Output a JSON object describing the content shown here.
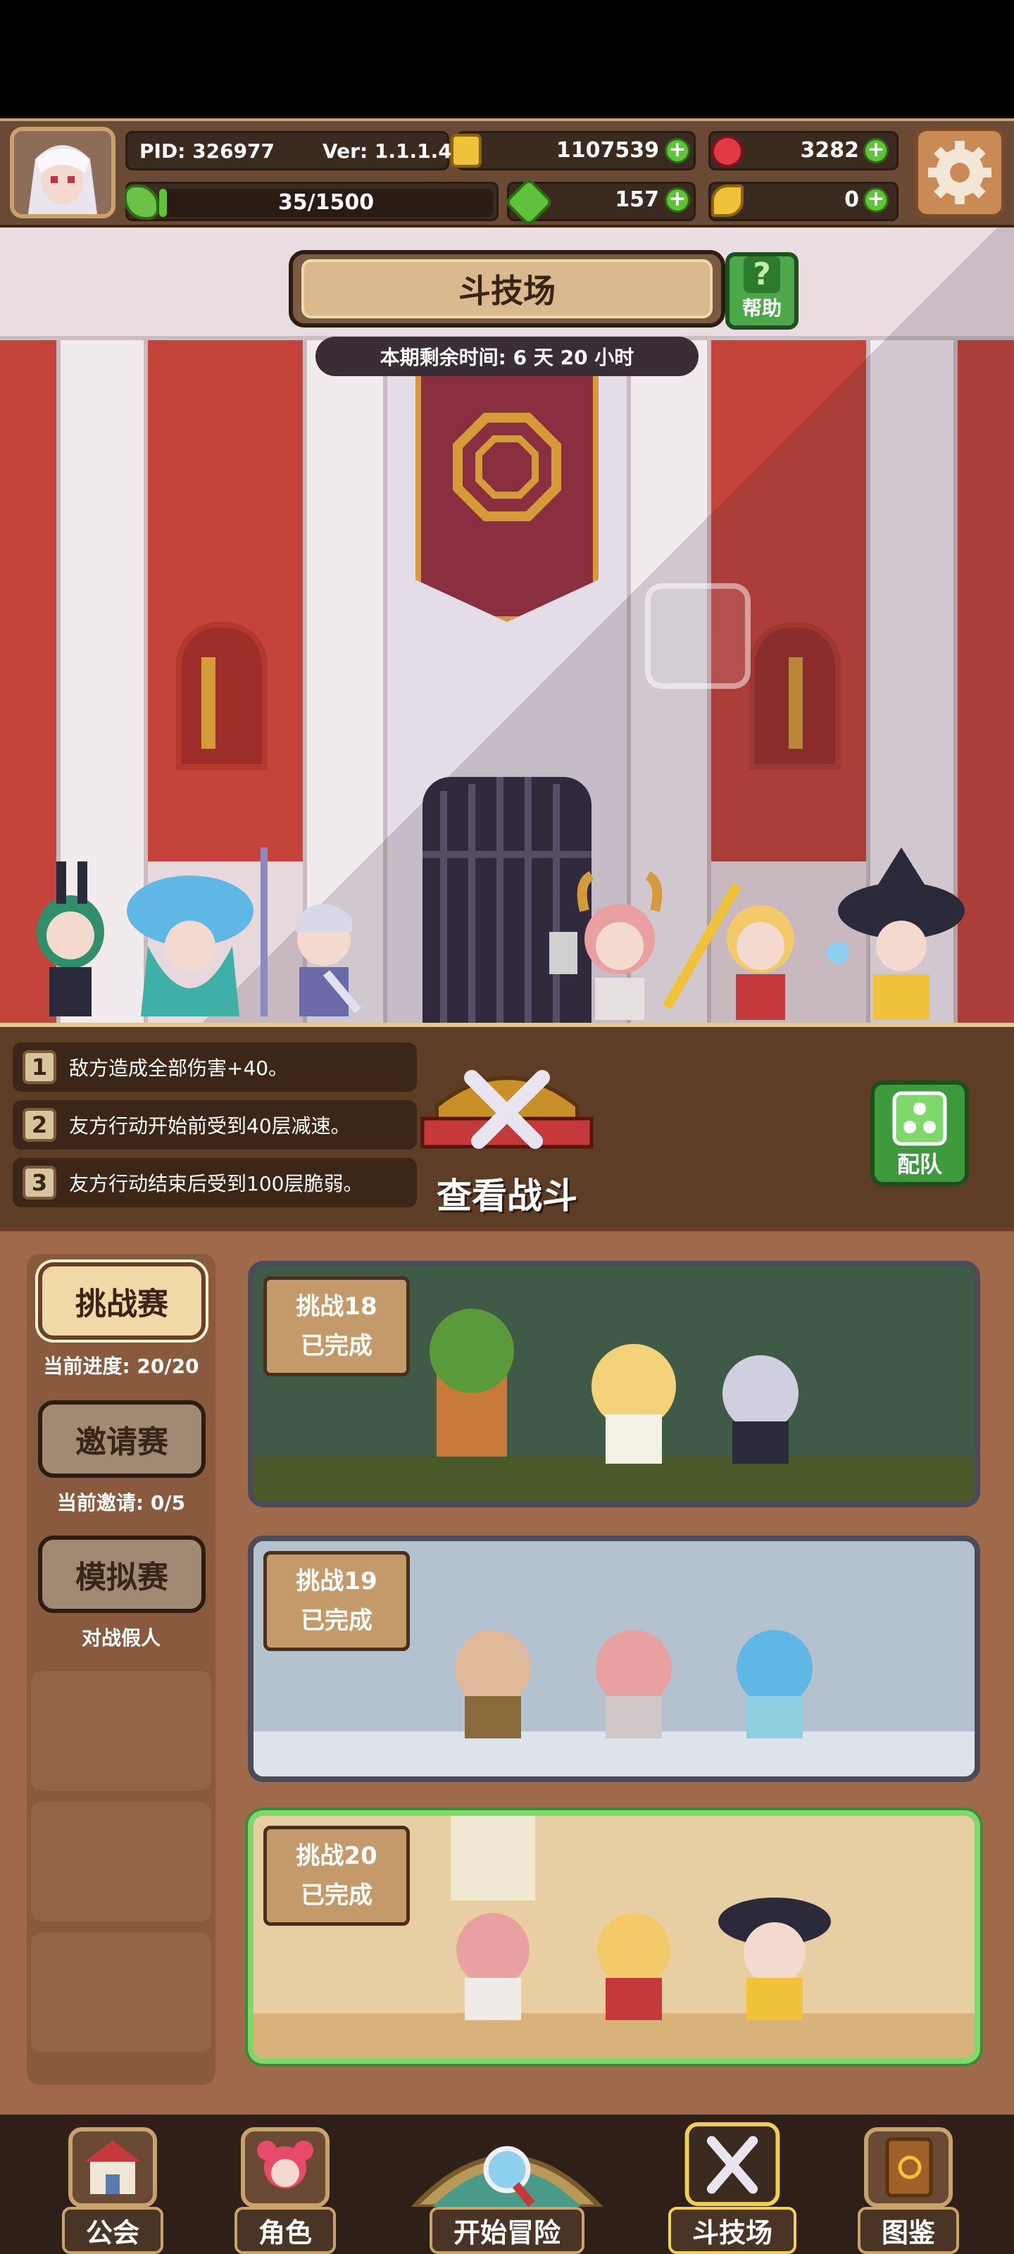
{
  "status": {
    "pid": "PID: 326977",
    "version": "Ver: 1.1.1.4",
    "gold": "1107539",
    "gems": "3282",
    "stamina": "35/1500",
    "clover": "157",
    "key": "0"
  },
  "arena": {
    "title": "斗技场",
    "help_label": "帮助",
    "timer": "本期剩余时间: 6 天 20 小时"
  },
  "rules": [
    {
      "num": "1",
      "text": "敌方造成全部伤害+40。"
    },
    {
      "num": "2",
      "text": "友方行动开始前受到40层减速。"
    },
    {
      "num": "3",
      "text": "友方行动结束后受到100层脆弱。"
    }
  ],
  "actions": {
    "view_battle": "查看战斗",
    "team": "配队"
  },
  "modes": [
    {
      "label": "挑战赛",
      "sub": "当前进度: 20/20"
    },
    {
      "label": "邀请赛",
      "sub": "当前邀请: 0/5"
    },
    {
      "label": "模拟赛",
      "sub": "对战假人"
    }
  ],
  "challenges": [
    {
      "name": "挑战18",
      "status": "已完成"
    },
    {
      "name": "挑战19",
      "status": "已完成"
    },
    {
      "name": "挑战20",
      "status": "已完成"
    }
  ],
  "nav": [
    {
      "label": "公会"
    },
    {
      "label": "角色"
    },
    {
      "label": "开始冒险"
    },
    {
      "label": "斗技场"
    },
    {
      "label": "图鉴"
    }
  ],
  "colors": {
    "accent_gold": "#c9a16b",
    "plus_green": "#5fc23a",
    "wall_red": "#c4433a",
    "panel_brown": "#5e3d27",
    "active_border": "#7fd96a"
  }
}
